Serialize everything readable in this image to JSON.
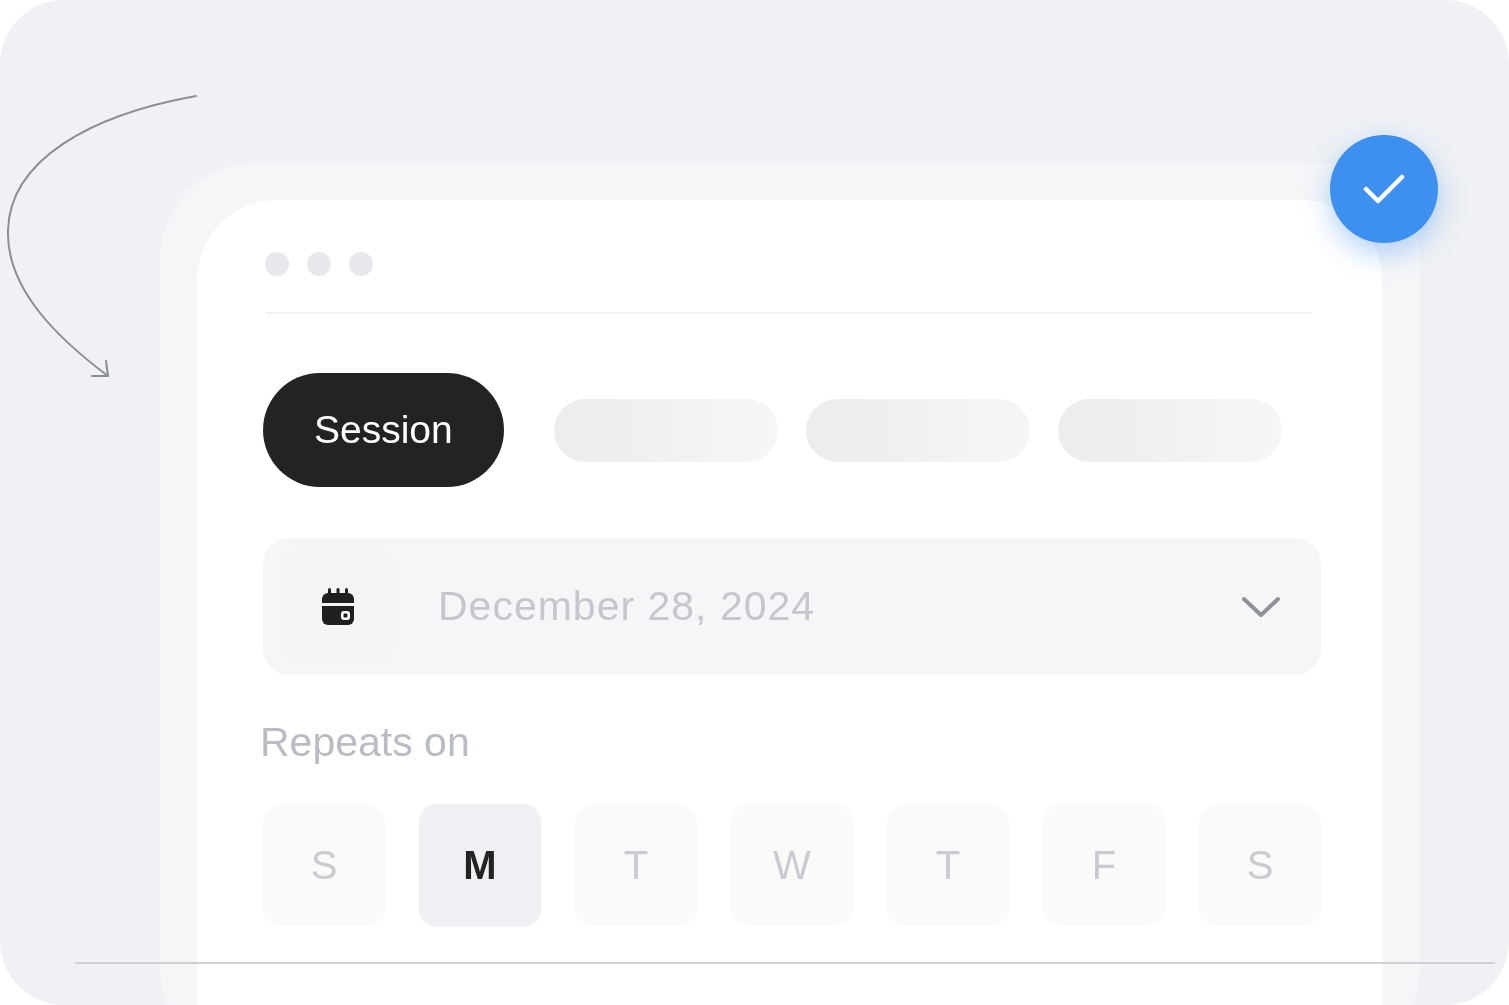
{
  "tabs": [
    {
      "label": "Session",
      "selected": true
    },
    {
      "selected": false
    },
    {
      "selected": false
    },
    {
      "selected": false
    }
  ],
  "date_field": {
    "value": "December 28, 2024"
  },
  "repeats_label": "Repeats on",
  "days": [
    {
      "label": "S",
      "selected": false
    },
    {
      "label": "M",
      "selected": true
    },
    {
      "label": "T",
      "selected": false
    },
    {
      "label": "W",
      "selected": false
    },
    {
      "label": "T",
      "selected": false
    },
    {
      "label": "F",
      "selected": false
    },
    {
      "label": "S",
      "selected": false
    }
  ]
}
